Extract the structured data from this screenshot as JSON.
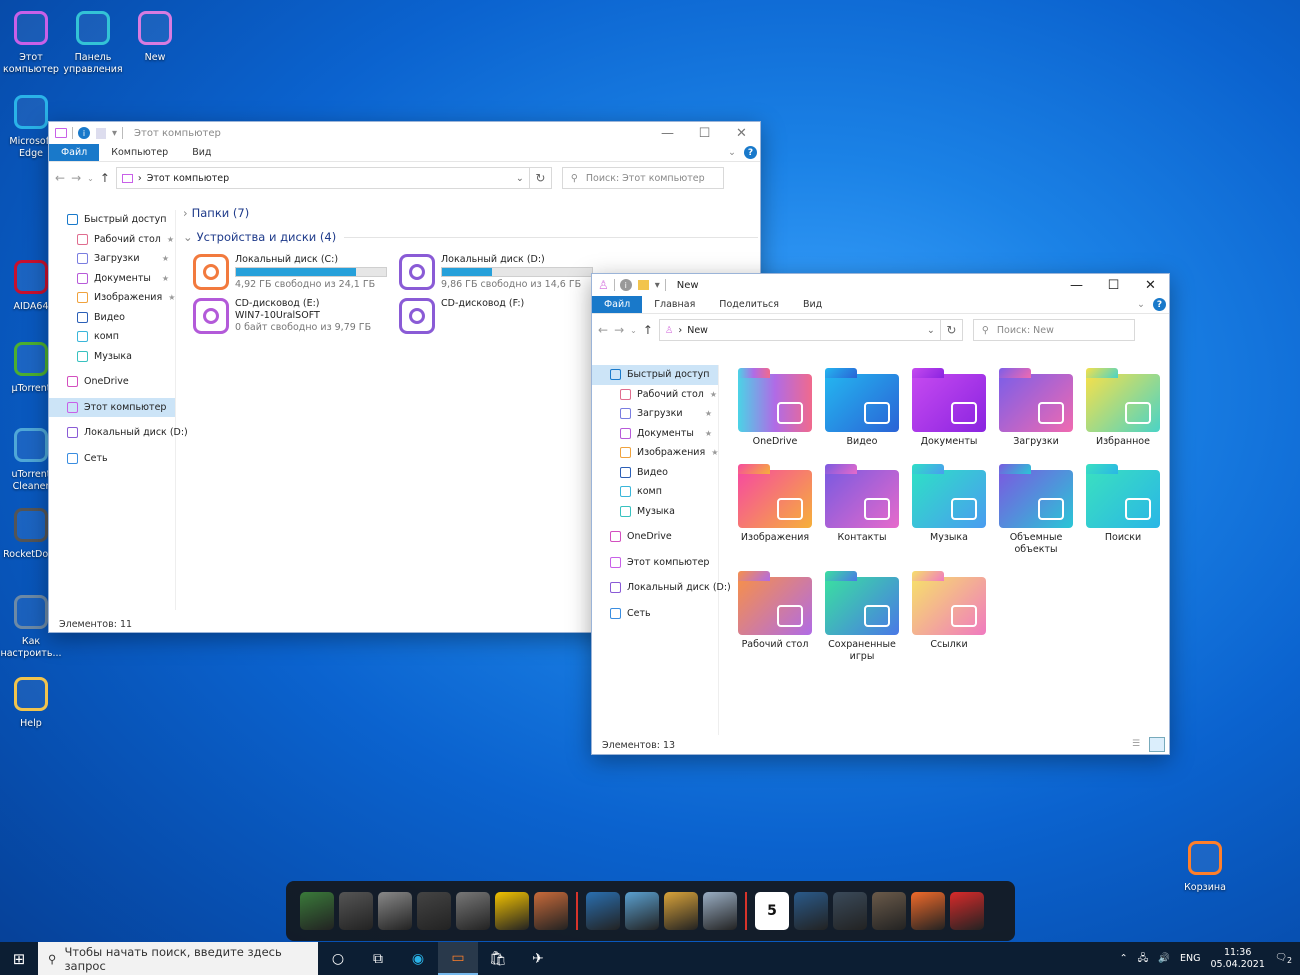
{
  "desktop": {
    "icons": [
      {
        "label": "Этот компьютер",
        "color": "#c860e8"
      },
      {
        "label": "Панель управления",
        "color": "#33c3d6"
      },
      {
        "label": "New",
        "color": "#d77be0"
      },
      {
        "label": "Microsoft Edge",
        "color": "#2ab3e8"
      },
      {
        "label": "AIDA64",
        "color": "#c8102e"
      },
      {
        "label": "µTorrent",
        "color": "#4caf30"
      },
      {
        "label": "uTorrent Cleaner",
        "color": "#4fa8d8"
      },
      {
        "label": "RocketDock",
        "color": "#555555"
      },
      {
        "label": "Как настроить...",
        "color": "#6d8aa6"
      },
      {
        "label": "Help",
        "color": "#f2c44d"
      },
      {
        "label": "Корзина",
        "color": "#ff7f2a"
      }
    ]
  },
  "win1": {
    "title": "Этот компьютер",
    "tabs": [
      "Файл",
      "Компьютер",
      "Вид"
    ],
    "address": "Этот компьютер",
    "search_placeholder": "Поиск: Этот компьютер",
    "nav": [
      {
        "label": "Быстрый доступ",
        "color": "#1979ca"
      },
      {
        "label": "Рабочий стол",
        "color": "#e06d8f",
        "pin": "★"
      },
      {
        "label": "Загрузки",
        "color": "#7a7de0",
        "pin": "★"
      },
      {
        "label": "Документы",
        "color": "#b75ad9",
        "pin": "★"
      },
      {
        "label": "Изображения",
        "color": "#f0a23c",
        "pin": "★"
      },
      {
        "label": "Видео",
        "color": "#2a5fb8"
      },
      {
        "label": "комп",
        "color": "#3ab6d9"
      },
      {
        "label": "Музыка",
        "color": "#38c1c0"
      },
      {
        "label": "OneDrive",
        "color": "#d34fbf"
      },
      {
        "label": "Этот компьютер",
        "color": "#c860e8"
      },
      {
        "label": "Локальный диск (D:)",
        "color": "#8a5bd6"
      },
      {
        "label": "Сеть",
        "color": "#3a8de0"
      }
    ],
    "groups": {
      "folders": "Папки (7)",
      "devices": "Устройства и диски (4)"
    },
    "drives": [
      {
        "name": "Локальный диск (C:)",
        "free": "4,92 ГБ свободно из 24,1 ГБ",
        "used": 0.8,
        "color": "#f27a3e"
      },
      {
        "name": "Локальный диск (D:)",
        "free": "9,86 ГБ свободно из 14,6 ГБ",
        "used": 0.33,
        "color": "#8a5bd6"
      },
      {
        "name": "CD-дисковод (E:)",
        "sub": "WIN7-10UralSOFT",
        "free": "0 байт свободно из 9,79 ГБ",
        "color": "#b35ad9"
      },
      {
        "name": "CD-дисковод (F:)",
        "color": "#8a5bd6"
      }
    ],
    "status": "Элементов: 11"
  },
  "win2": {
    "title": "New",
    "tabs": [
      "Файл",
      "Главная",
      "Поделиться",
      "Вид"
    ],
    "address": "New",
    "search_placeholder": "Поиск: New",
    "nav": [
      {
        "label": "Быстрый доступ",
        "color": "#1979ca"
      },
      {
        "label": "Рабочий стол",
        "color": "#e06d8f",
        "pin": "★"
      },
      {
        "label": "Загрузки",
        "color": "#7a7de0",
        "pin": "★"
      },
      {
        "label": "Документы",
        "color": "#b75ad9",
        "pin": "★"
      },
      {
        "label": "Изображения",
        "color": "#f0a23c",
        "pin": "★"
      },
      {
        "label": "Видео",
        "color": "#2a5fb8"
      },
      {
        "label": "комп",
        "color": "#3ab6d9"
      },
      {
        "label": "Музыка",
        "color": "#38c1c0"
      },
      {
        "label": "OneDrive",
        "color": "#d34fbf"
      },
      {
        "label": "Этот компьютер",
        "color": "#c860e8"
      },
      {
        "label": "Локальный диск (D:)",
        "color": "#8a5bd6"
      },
      {
        "label": "Сеть",
        "color": "#3a8de0"
      }
    ],
    "items": [
      {
        "label": "OneDrive",
        "grad": "linear-gradient(90deg,#4bd3e6,#b06be6,#f06a8d)"
      },
      {
        "label": "Видео",
        "grad": "linear-gradient(135deg,#24b6f0,#2a63d6)"
      },
      {
        "label": "Документы",
        "grad": "linear-gradient(135deg,#c64af0,#8a24e0)"
      },
      {
        "label": "Загрузки",
        "grad": "linear-gradient(135deg,#7c5ee8,#f06ab0)"
      },
      {
        "label": "Избранное",
        "grad": "linear-gradient(135deg,#f6e04a,#4ad3c6)"
      },
      {
        "label": "Изображения",
        "grad": "linear-gradient(135deg,#f64aa0,#f6b03a)"
      },
      {
        "label": "Контакты",
        "grad": "linear-gradient(135deg,#7a5ae0,#e66acb)"
      },
      {
        "label": "Музыка",
        "grad": "linear-gradient(135deg,#2ee0c6,#4a9cf0)"
      },
      {
        "label": "Объемные объекты",
        "grad": "linear-gradient(135deg,#7a5ae0,#2ac6d6)"
      },
      {
        "label": "Поиски",
        "grad": "linear-gradient(135deg,#3ae0c0,#2ab6e6)"
      },
      {
        "label": "Рабочий стол",
        "grad": "linear-gradient(135deg,#f6904a,#b06be6)"
      },
      {
        "label": "Сохраненные игры",
        "grad": "linear-gradient(135deg,#3ae0a0,#4a78e6)"
      },
      {
        "label": "Ссылки",
        "grad": "linear-gradient(135deg,#f6e06a,#f07ac0)"
      }
    ],
    "status": "Элементов: 13"
  },
  "taskbar": {
    "search": "Чтобы начать поиск, введите здесь запрос",
    "lang": "ENG",
    "time": "11:36",
    "date": "05.04.2021",
    "notif": "2"
  },
  "dock": {
    "calendar_day": "5"
  }
}
